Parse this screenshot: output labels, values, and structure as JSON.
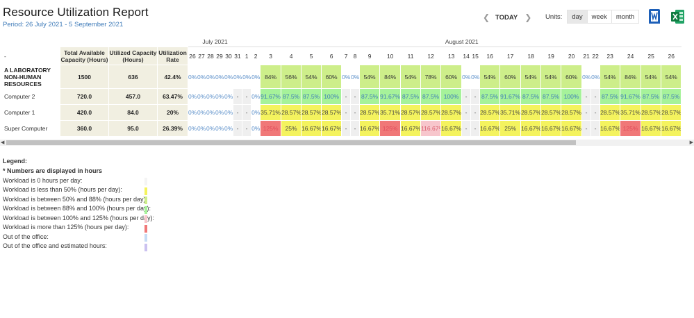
{
  "header": {
    "title": "Resource Utilization Report",
    "period": "Period: 26 July 2021 - 5 September 2021"
  },
  "nav": {
    "prev_icon": "chevron-left-icon",
    "today_label": "TODAY",
    "next_icon": "chevron-right-icon"
  },
  "units": {
    "label": "Units:",
    "options": [
      "day",
      "week",
      "month"
    ],
    "selected": "day"
  },
  "export": {
    "word_icon": "word-icon",
    "excel_icon": "excel-icon"
  },
  "table": {
    "corner": "-",
    "col_total": "Total Available Capacity (Hours)",
    "col_utilized": "Utilized Capacity (Hours)",
    "col_rate": "Utilization Rate",
    "months": [
      {
        "name": "July 2021",
        "span": 6
      },
      {
        "name": "August 2021",
        "span": 24
      }
    ],
    "days": [
      "26",
      "27",
      "28",
      "29",
      "30",
      "31",
      "1",
      "2",
      "3",
      "4",
      "5",
      "6",
      "7",
      "8",
      "9",
      "10",
      "11",
      "12",
      "13",
      "14",
      "15",
      "16",
      "17",
      "18",
      "19",
      "20",
      "21",
      "22",
      "23",
      "24",
      "25",
      "26"
    ],
    "rows": [
      {
        "name": "A LABORATORY NON-HUMAN RESOURCES",
        "total": "1500",
        "utilized": "636",
        "rate": "42.4%",
        "cells": [
          "0%",
          "0%",
          "0%",
          "0%",
          "0%",
          "0%",
          "0%",
          "0%",
          "84%",
          "56%",
          "54%",
          "60%",
          "0%",
          "0%",
          "54%",
          "84%",
          "54%",
          "78%",
          "60%",
          "0%",
          "0%",
          "54%",
          "60%",
          "54%",
          "54%",
          "60%",
          "0%",
          "0%",
          "54%",
          "84%",
          "54%",
          "54%"
        ],
        "levels": [
          "z",
          "z",
          "z",
          "z",
          "z",
          "z",
          "z",
          "z",
          "g",
          "g",
          "g",
          "g",
          "z",
          "z",
          "g",
          "g",
          "g",
          "g",
          "g",
          "z",
          "z",
          "g",
          "g",
          "g",
          "g",
          "g",
          "z",
          "z",
          "g",
          "g",
          "g",
          "g"
        ]
      },
      {
        "name": "Computer 2",
        "total": "720.0",
        "utilized": "457.0",
        "rate": "63.47%",
        "cells": [
          "0%",
          "0%",
          "0%",
          "0%",
          "0%",
          "-",
          "-",
          "0%",
          "91.67%",
          "87.5%",
          "87.5%",
          "100%",
          "-",
          "-",
          "87.5%",
          "91.67%",
          "87.5%",
          "87.5%",
          "100%",
          "-",
          "-",
          "87.5%",
          "91.67%",
          "87.5%",
          "87.5%",
          "100%",
          "-",
          "-",
          "87.5%",
          "91.67%",
          "87.5%",
          "87.5%"
        ],
        "levels": [
          "z",
          "z",
          "z",
          "z",
          "z",
          "w",
          "w",
          "z",
          "b",
          "b",
          "b",
          "b",
          "w",
          "w",
          "b",
          "b",
          "b",
          "b",
          "b",
          "w",
          "w",
          "b",
          "b",
          "b",
          "b",
          "b",
          "w",
          "w",
          "b",
          "b",
          "b",
          "b"
        ]
      },
      {
        "name": "Computer 1",
        "total": "420.0",
        "utilized": "84.0",
        "rate": "20%",
        "cells": [
          "0%",
          "0%",
          "0%",
          "0%",
          "0%",
          "-",
          "-",
          "0%",
          "35.71%",
          "28.57%",
          "28.57%",
          "28.57%",
          "-",
          "-",
          "28.57%",
          "35.71%",
          "28.57%",
          "28.57%",
          "28.57%",
          "-",
          "-",
          "28.57%",
          "35.71%",
          "28.57%",
          "28.57%",
          "28.57%",
          "-",
          "-",
          "28.57%",
          "35.71%",
          "28.57%",
          "28.57%"
        ],
        "levels": [
          "z",
          "z",
          "z",
          "z",
          "z",
          "w",
          "w",
          "z",
          "y",
          "y",
          "y",
          "y",
          "w",
          "w",
          "y",
          "y",
          "y",
          "y",
          "y",
          "w",
          "w",
          "y",
          "y",
          "y",
          "y",
          "y",
          "w",
          "w",
          "y",
          "y",
          "y",
          "y"
        ]
      },
      {
        "name": "Super Computer",
        "total": "360.0",
        "utilized": "95.0",
        "rate": "26.39%",
        "cells": [
          "0%",
          "0%",
          "0%",
          "0%",
          "0%",
          "-",
          "-",
          "0%",
          "125%",
          "25%",
          "16.67%",
          "16.67%",
          "-",
          "-",
          "16.67%",
          "125%",
          "16.67%",
          "116.67%",
          "16.67%",
          "-",
          "-",
          "16.67%",
          "25%",
          "16.67%",
          "16.67%",
          "16.67%",
          "-",
          "-",
          "16.67%",
          "125%",
          "16.67%",
          "16.67%"
        ],
        "levels": [
          "z",
          "z",
          "z",
          "z",
          "z",
          "w",
          "w",
          "z",
          "r",
          "y",
          "y",
          "y",
          "w",
          "w",
          "y",
          "r",
          "y",
          "p",
          "y",
          "w",
          "w",
          "y",
          "y",
          "y",
          "y",
          "y",
          "w",
          "w",
          "y",
          "r",
          "y",
          "y"
        ]
      }
    ]
  },
  "level_colors": {
    "z": "#ffffff",
    "w": "#ffffff",
    "y": "#f4f35e",
    "g": "#cdee8a",
    "b": "#a6f29a",
    "p": "#f7c6cc",
    "r": "#f07878",
    "o": "#c6dcf5",
    "e": "#cbc2f0"
  },
  "level_text_colors": {
    "z": "#5b8fc9",
    "w": "#444444",
    "y": "#444444",
    "g": "#333333",
    "b": "#3d7ab8",
    "p": "#d95a6a",
    "r": "#e04a5a"
  },
  "legend": {
    "title": "Legend:",
    "note": "* Numbers are displayed in hours",
    "items": [
      {
        "label": "Workload is 0 hours per day:",
        "color": "#f4f4f4"
      },
      {
        "label": "Workload is less than 50% (hours per day):",
        "color": "#f4f35e"
      },
      {
        "label": "Workload is between 50% and 88% (hours per day):",
        "color": "#cdee8a"
      },
      {
        "label": "Workload is between 88% and 100% (hours per day):",
        "color": "#a6f29a"
      },
      {
        "label": "Workload is between 100% and 125% (hours per day):",
        "color": "#f7c6cc"
      },
      {
        "label": "Workload is more than 125% (hours per day):",
        "color": "#f07878"
      },
      {
        "label": "Out of the office:",
        "color": "#c6dcf5"
      },
      {
        "label": "Out of the office and estimated hours:",
        "color": "#cbc2f0"
      }
    ]
  }
}
